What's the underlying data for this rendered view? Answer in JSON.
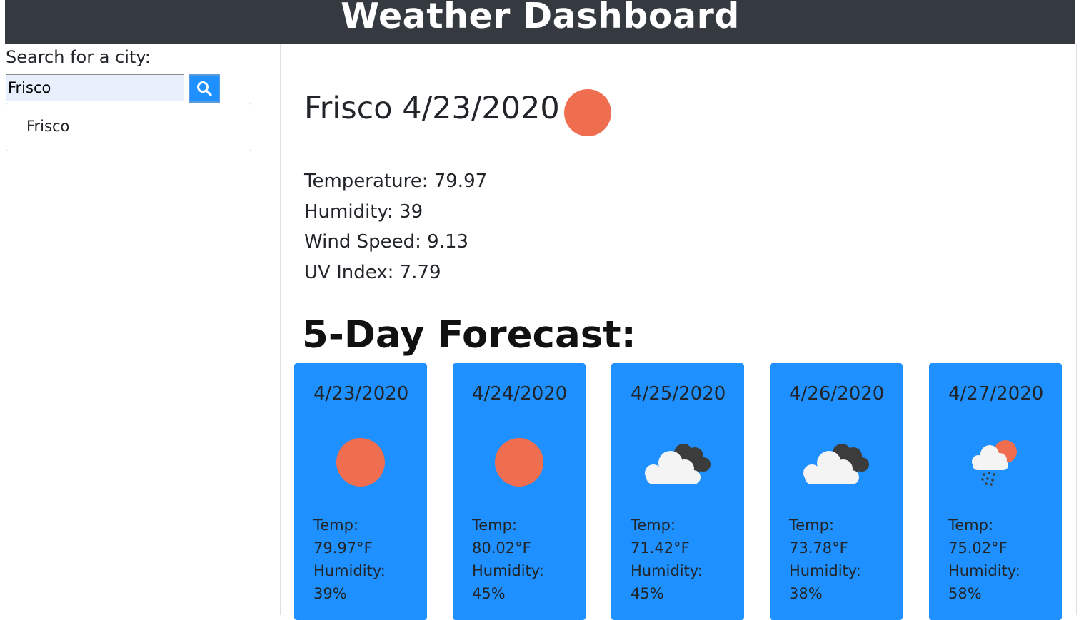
{
  "header": {
    "title": "Weather Dashboard"
  },
  "search": {
    "label": "Search for a city:",
    "value": "Frisco",
    "button_icon": "search-icon"
  },
  "history": [
    {
      "label": "Frisco"
    }
  ],
  "current": {
    "title": "Frisco 4/23/2020",
    "icon": "sun-icon",
    "temperature": "Temperature: 79.97",
    "humidity": "Humidity: 39",
    "wind": "Wind Speed: 9.13",
    "uv": "UV Index: 7.79"
  },
  "forecast": {
    "title": "5-Day Forecast:",
    "temp_label": "Temp:",
    "humidity_label": "Humidity:",
    "days": [
      {
        "date": "4/23/2020",
        "icon": "sun-icon",
        "temp": "79.97°F",
        "humidity": "39%"
      },
      {
        "date": "4/24/2020",
        "icon": "sun-icon",
        "temp": "80.02°F",
        "humidity": "45%"
      },
      {
        "date": "4/25/2020",
        "icon": "cloudy-icon",
        "temp": "71.42°F",
        "humidity": "45%"
      },
      {
        "date": "4/26/2020",
        "icon": "cloudy-icon",
        "temp": "73.78°F",
        "humidity": "38%"
      },
      {
        "date": "4/27/2020",
        "icon": "rain-sun-icon",
        "temp": "75.02°F",
        "humidity": "58%"
      }
    ]
  },
  "colors": {
    "header_bg": "#343a40",
    "card_bg": "#1e90ff",
    "sun": "#ee6e4f"
  }
}
